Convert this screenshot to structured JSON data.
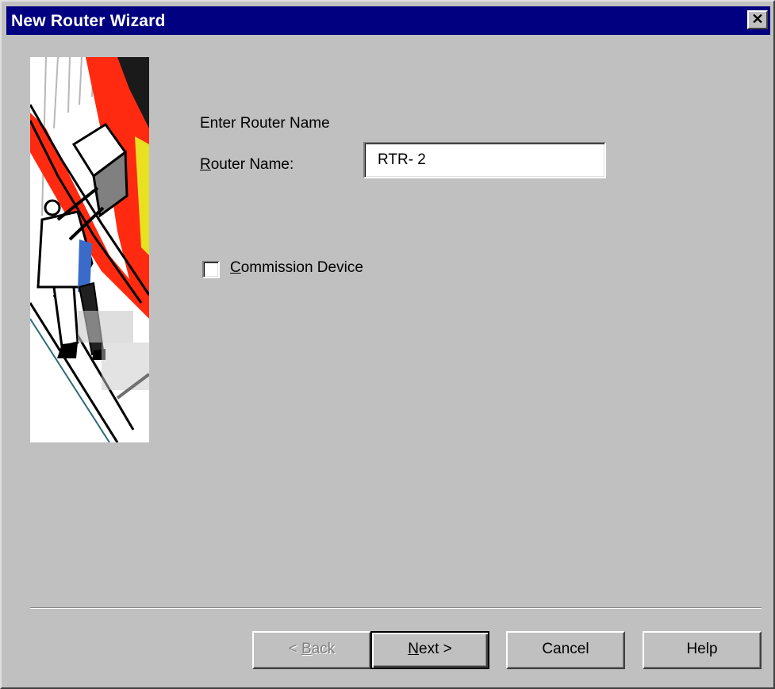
{
  "window": {
    "title": "New Router Wizard",
    "close_glyph": "✕"
  },
  "content": {
    "heading": "Enter Router Name",
    "router_name_label_accel": "R",
    "router_name_label_rest": "outer Name:",
    "router_name_value": "RTR- 2",
    "commission_accel": "C",
    "commission_rest": "ommission Device",
    "commission_checked": false
  },
  "buttons": {
    "back_prefix": "< ",
    "back_accel": "B",
    "back_rest": "ack",
    "next_accel": "N",
    "next_rest": "ext >",
    "cancel": "Cancel",
    "help": "Help"
  },
  "colors": {
    "title_bar": "#000080",
    "dialog_face": "#c0c0c0",
    "illustration_accent": "#ff2a10"
  },
  "icons": {
    "close": "close-icon",
    "illustration": "wizard-illustration"
  }
}
